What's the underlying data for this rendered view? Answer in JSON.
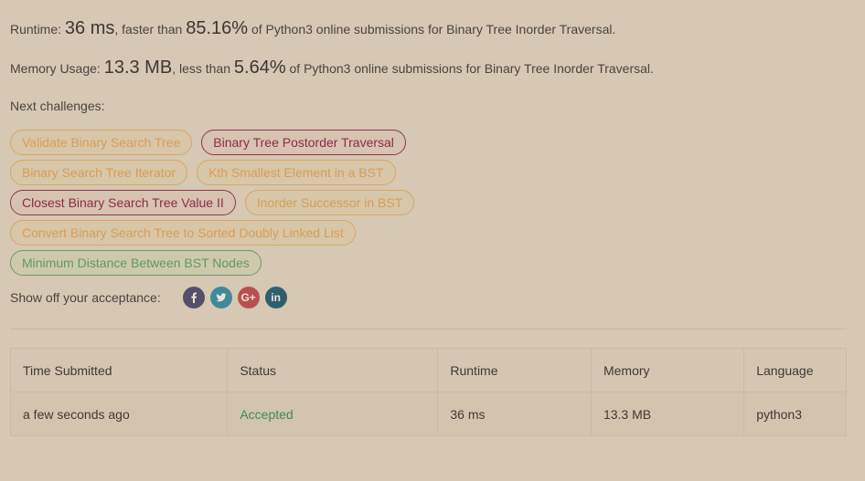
{
  "result": {
    "runtime_label": "Runtime: ",
    "runtime_value": "36 ms",
    "runtime_mid": ", faster than ",
    "runtime_pct": "85.16%",
    "runtime_tail": " of Python3 online submissions for Binary Tree Inorder Traversal.",
    "memory_label": "Memory Usage: ",
    "memory_value": "13.3 MB",
    "memory_mid": ", less than ",
    "memory_pct": "5.64%",
    "memory_tail": " of Python3 online submissions for Binary Tree Inorder Traversal."
  },
  "next": {
    "label": "Next challenges:",
    "rows": [
      [
        {
          "label": "Validate Binary Search Tree",
          "difficulty": "easy"
        },
        {
          "label": "Binary Tree Postorder Traversal",
          "difficulty": "medium"
        }
      ],
      [
        {
          "label": "Binary Search Tree Iterator",
          "difficulty": "easy"
        },
        {
          "label": "Kth Smallest Element in a BST",
          "difficulty": "easy"
        }
      ],
      [
        {
          "label": "Closest Binary Search Tree Value II",
          "difficulty": "medium"
        },
        {
          "label": "Inorder Successor in BST",
          "difficulty": "easy"
        }
      ],
      [
        {
          "label": "Convert Binary Search Tree to Sorted Doubly Linked List",
          "difficulty": "easy"
        }
      ],
      [
        {
          "label": "Minimum Distance Between BST Nodes",
          "difficulty": "easy-green"
        }
      ]
    ]
  },
  "share": {
    "label": "Show off your acceptance:",
    "icons": [
      {
        "name": "facebook-icon",
        "glyph": "f",
        "color": "#55506a"
      },
      {
        "name": "twitter-icon",
        "glyph": "t",
        "color": "#3f8a9a"
      },
      {
        "name": "google-plus-icon",
        "glyph": "G+",
        "color": "#b94f4f"
      },
      {
        "name": "linkedin-icon",
        "glyph": "in",
        "color": "#2f5f6e"
      }
    ]
  },
  "table": {
    "headers": [
      "Time Submitted",
      "Status",
      "Runtime",
      "Memory",
      "Language"
    ],
    "rows": [
      [
        "a few seconds ago",
        "Accepted",
        "36 ms",
        "13.3 MB",
        "python3"
      ]
    ]
  }
}
